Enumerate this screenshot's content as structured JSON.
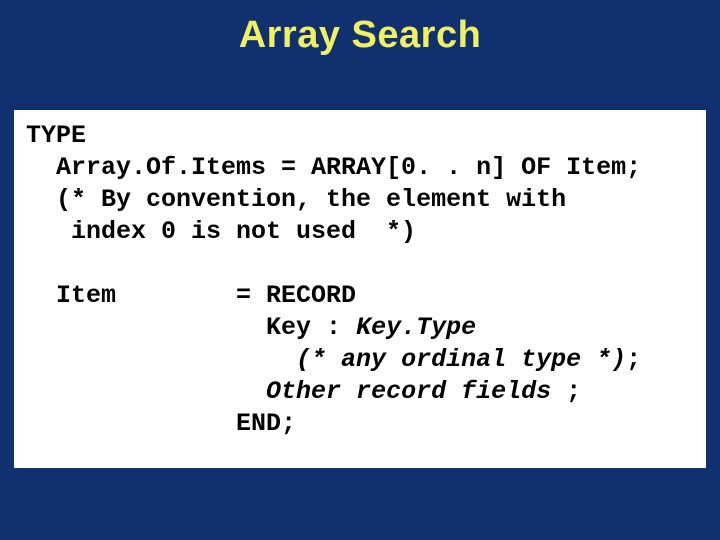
{
  "title": "Array Search",
  "code": {
    "l1": "TYPE",
    "l2": "  Array.Of.Items = ARRAY[0. . n] OF Item;",
    "l3": "  (* By convention, the element with",
    "l4": "   index 0 is not used  *)",
    "l5": "",
    "l6a": "  Item        = RECORD",
    "l7a": "                Key : ",
    "l7b": "Key.Type",
    "l8a": "                  ",
    "l8b": "(* any ordinal type *)",
    "l8c": ";",
    "l9a": "                ",
    "l9b": "Other record fields ",
    "l9c": ";",
    "l10": "              END;"
  }
}
